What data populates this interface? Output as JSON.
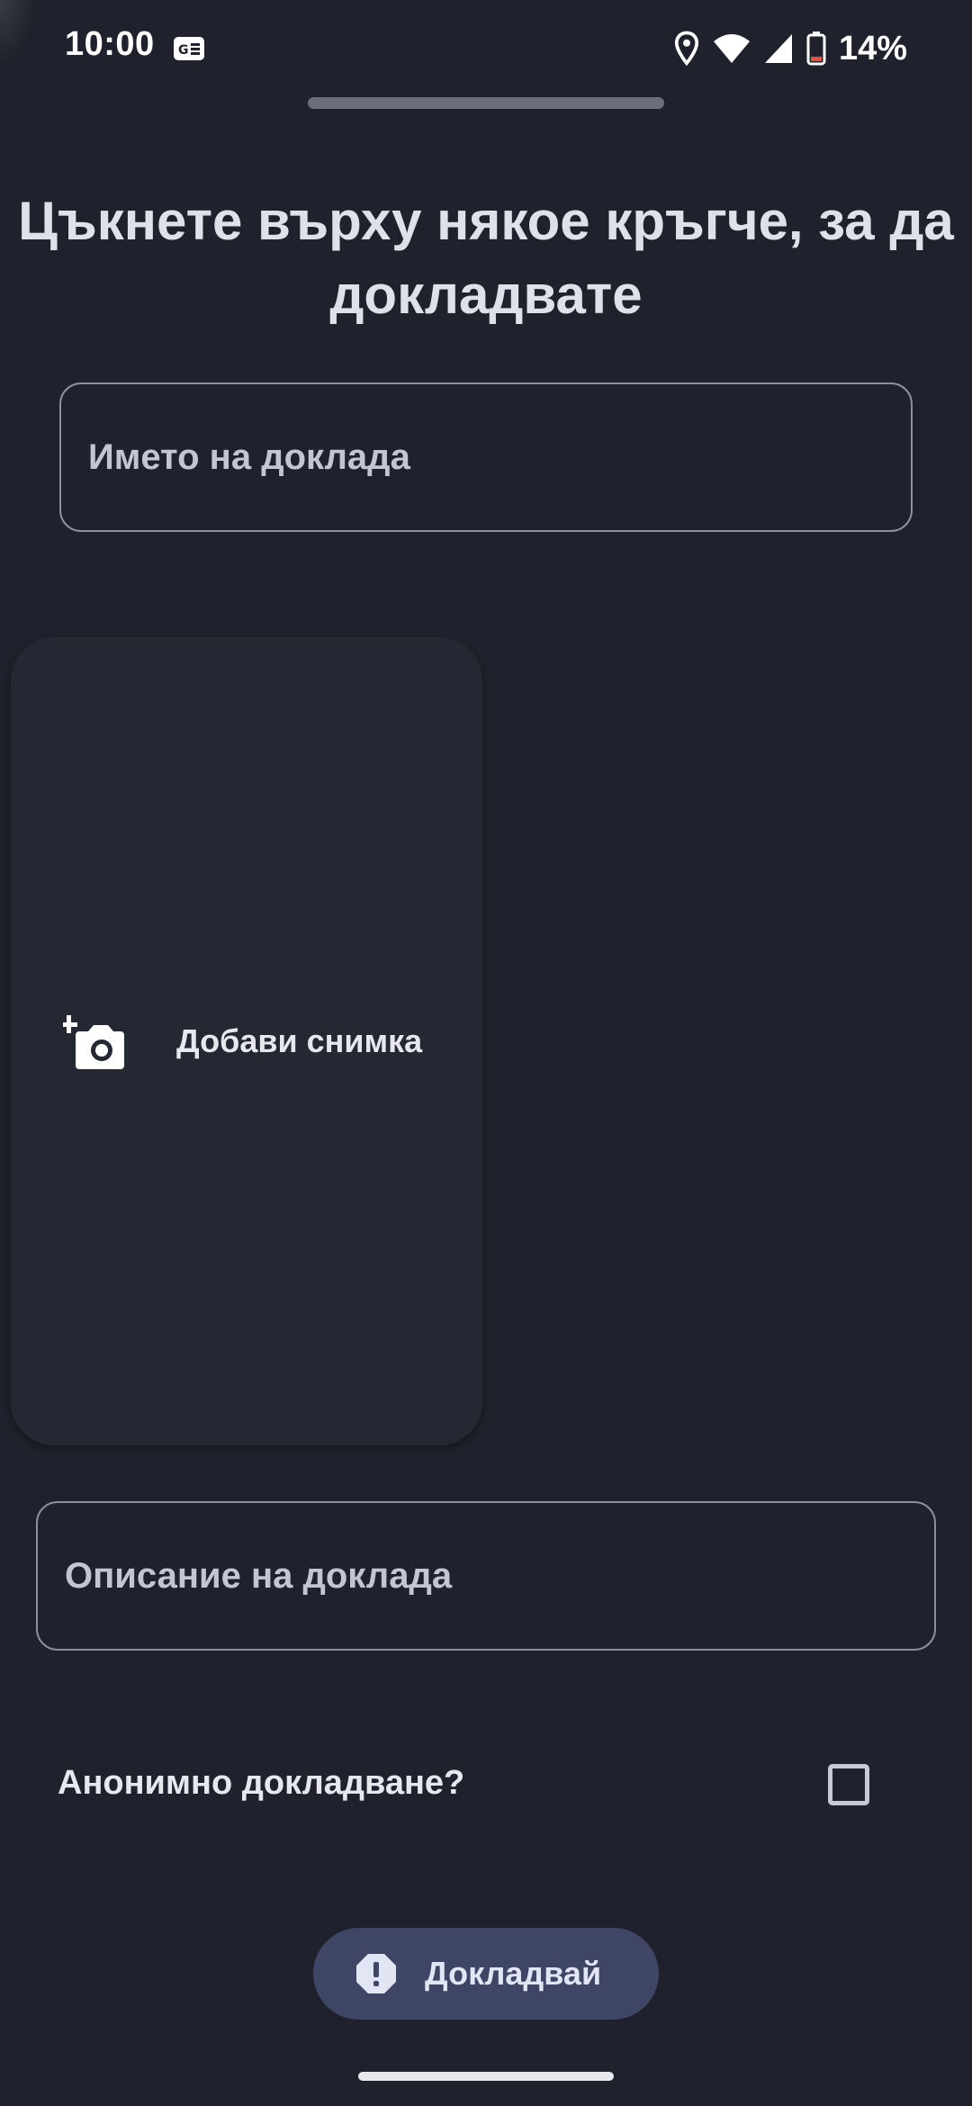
{
  "status_bar": {
    "time": "10:00",
    "battery_percent": "14%",
    "icons": [
      "ge-notification-icon",
      "location-icon",
      "wifi-icon",
      "cell-signal-icon",
      "battery-icon"
    ]
  },
  "headline": "Цъкнете върху някое кръгче, за да докладвате",
  "report_name_field": {
    "placeholder": "Името на доклада",
    "value": ""
  },
  "photo_card": {
    "label": "Добави снимка",
    "icon": "add-photo-icon"
  },
  "description_field": {
    "placeholder": "Описание на доклада",
    "value": ""
  },
  "anonymous": {
    "label": "Анонимно докладване?",
    "checked": false
  },
  "report_button": {
    "label": "Докладвай",
    "icon": "alert-octagon-icon"
  },
  "colors": {
    "background": "#1f222c",
    "card": "#232833",
    "button": "#3f4564",
    "outline": "#8d909b"
  }
}
